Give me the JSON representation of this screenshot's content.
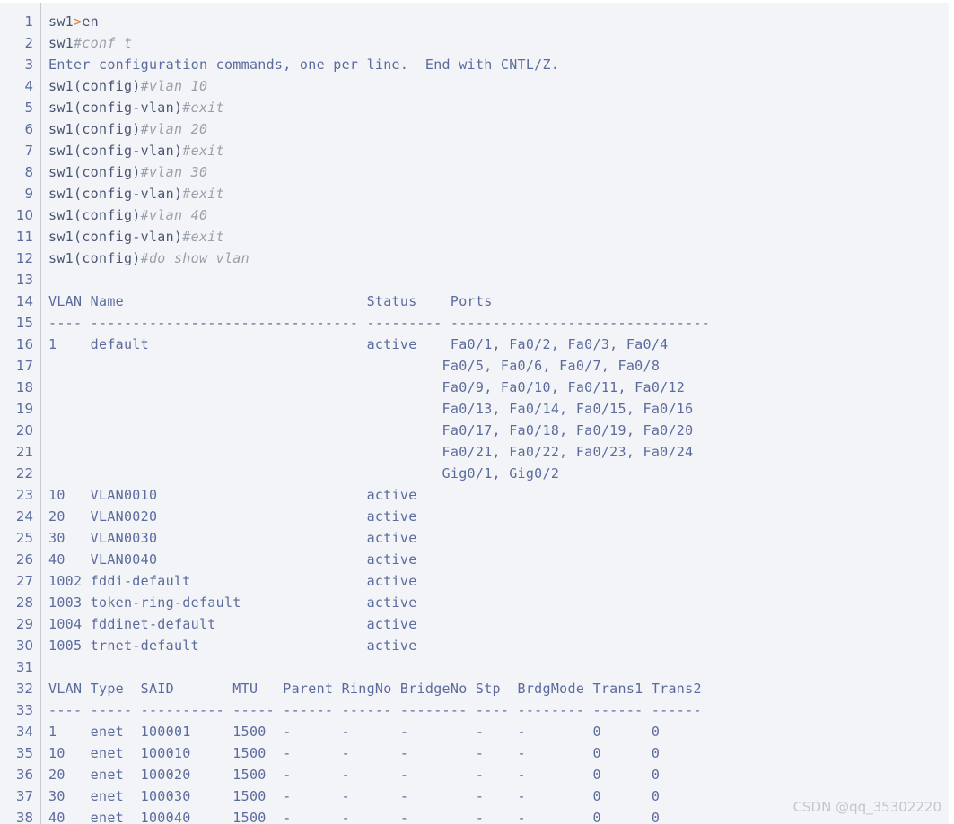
{
  "terminal": {
    "device_prompt": "sw1",
    "watermark": "CSDN @qq_35302220",
    "line_count": 38,
    "colors": {
      "background": "#f2f4f7",
      "gutter_text": "#5c6b9e",
      "gutter_divider": "#c6c9cf",
      "code_text": "#4a5673",
      "output_text": "#5b6b9e",
      "comment_italic": "#9aa0a9",
      "operator": "#d2834a",
      "watermark": "#c3c6cb"
    },
    "lines": [
      {
        "n": 1,
        "parts": [
          {
            "t": "sw1",
            "c": "tok-prompt"
          },
          {
            "t": ">",
            "c": "tok-op"
          },
          {
            "t": "en",
            "c": "tok-plain"
          }
        ]
      },
      {
        "n": 2,
        "parts": [
          {
            "t": "sw1",
            "c": "tok-prompt"
          },
          {
            "t": "#conf t",
            "c": "tok-cmd"
          }
        ]
      },
      {
        "n": 3,
        "parts": [
          {
            "t": "Enter configuration commands, one per line.  End with CNTL/Z.",
            "c": "tok-out"
          }
        ]
      },
      {
        "n": 4,
        "parts": [
          {
            "t": "sw1(config)",
            "c": "tok-prompt"
          },
          {
            "t": "#vlan 10",
            "c": "tok-cmd"
          }
        ]
      },
      {
        "n": 5,
        "parts": [
          {
            "t": "sw1(config-vlan)",
            "c": "tok-prompt"
          },
          {
            "t": "#exit",
            "c": "tok-cmd"
          }
        ]
      },
      {
        "n": 6,
        "parts": [
          {
            "t": "sw1(config)",
            "c": "tok-prompt"
          },
          {
            "t": "#vlan 20",
            "c": "tok-cmd"
          }
        ]
      },
      {
        "n": 7,
        "parts": [
          {
            "t": "sw1(config-vlan)",
            "c": "tok-prompt"
          },
          {
            "t": "#exit",
            "c": "tok-cmd"
          }
        ]
      },
      {
        "n": 8,
        "parts": [
          {
            "t": "sw1(config)",
            "c": "tok-prompt"
          },
          {
            "t": "#vlan 30",
            "c": "tok-cmd"
          }
        ]
      },
      {
        "n": 9,
        "parts": [
          {
            "t": "sw1(config-vlan)",
            "c": "tok-prompt"
          },
          {
            "t": "#exit",
            "c": "tok-cmd"
          }
        ]
      },
      {
        "n": 10,
        "parts": [
          {
            "t": "sw1(config)",
            "c": "tok-prompt"
          },
          {
            "t": "#vlan 40",
            "c": "tok-cmd"
          }
        ]
      },
      {
        "n": 11,
        "parts": [
          {
            "t": "sw1(config-vlan)",
            "c": "tok-prompt"
          },
          {
            "t": "#exit",
            "c": "tok-cmd"
          }
        ]
      },
      {
        "n": 12,
        "parts": [
          {
            "t": "sw1(config)",
            "c": "tok-prompt"
          },
          {
            "t": "#do show vlan",
            "c": "tok-cmd"
          }
        ]
      },
      {
        "n": 13,
        "parts": [
          {
            "t": "",
            "c": "tok-out"
          }
        ]
      },
      {
        "n": 14,
        "parts": [
          {
            "t": "VLAN Name                             Status    Ports",
            "c": "tok-out"
          }
        ]
      },
      {
        "n": 15,
        "parts": [
          {
            "t": "---- -------------------------------- --------- -------------------------------",
            "c": "tok-out"
          }
        ]
      },
      {
        "n": 16,
        "parts": [
          {
            "t": "1    default                          active    Fa0/1, Fa0/2, Fa0/3, Fa0/4",
            "c": "tok-out"
          }
        ]
      },
      {
        "n": 17,
        "parts": [
          {
            "t": "                                               Fa0/5, Fa0/6, Fa0/7, Fa0/8",
            "c": "tok-out"
          }
        ]
      },
      {
        "n": 18,
        "parts": [
          {
            "t": "                                               Fa0/9, Fa0/10, Fa0/11, Fa0/12",
            "c": "tok-out"
          }
        ]
      },
      {
        "n": 19,
        "parts": [
          {
            "t": "                                               Fa0/13, Fa0/14, Fa0/15, Fa0/16",
            "c": "tok-out"
          }
        ]
      },
      {
        "n": 20,
        "parts": [
          {
            "t": "                                               Fa0/17, Fa0/18, Fa0/19, Fa0/20",
            "c": "tok-out"
          }
        ]
      },
      {
        "n": 21,
        "parts": [
          {
            "t": "                                               Fa0/21, Fa0/22, Fa0/23, Fa0/24",
            "c": "tok-out"
          }
        ]
      },
      {
        "n": 22,
        "parts": [
          {
            "t": "                                               Gig0/1, Gig0/2",
            "c": "tok-out"
          }
        ]
      },
      {
        "n": 23,
        "parts": [
          {
            "t": "10   VLAN0010                         active",
            "c": "tok-out"
          }
        ]
      },
      {
        "n": 24,
        "parts": [
          {
            "t": "20   VLAN0020                         active",
            "c": "tok-out"
          }
        ]
      },
      {
        "n": 25,
        "parts": [
          {
            "t": "30   VLAN0030                         active",
            "c": "tok-out"
          }
        ]
      },
      {
        "n": 26,
        "parts": [
          {
            "t": "40   VLAN0040                         active",
            "c": "tok-out"
          }
        ]
      },
      {
        "n": 27,
        "parts": [
          {
            "t": "1002 fddi-default                     active",
            "c": "tok-out"
          }
        ]
      },
      {
        "n": 28,
        "parts": [
          {
            "t": "1003 token-ring-default               active",
            "c": "tok-out"
          }
        ]
      },
      {
        "n": 29,
        "parts": [
          {
            "t": "1004 fddinet-default                  active",
            "c": "tok-out"
          }
        ]
      },
      {
        "n": 30,
        "parts": [
          {
            "t": "1005 trnet-default                    active",
            "c": "tok-out"
          }
        ]
      },
      {
        "n": 31,
        "parts": [
          {
            "t": "",
            "c": "tok-out"
          }
        ]
      },
      {
        "n": 32,
        "parts": [
          {
            "t": "VLAN Type  SAID       MTU   Parent RingNo BridgeNo Stp  BrdgMode Trans1 Trans2",
            "c": "tok-out"
          }
        ]
      },
      {
        "n": 33,
        "parts": [
          {
            "t": "---- ----- ---------- ----- ------ ------ -------- ---- -------- ------ ------",
            "c": "tok-out"
          }
        ]
      },
      {
        "n": 34,
        "parts": [
          {
            "t": "1    enet  100001     1500  -      -      -        -    -        0      0",
            "c": "tok-out"
          }
        ]
      },
      {
        "n": 35,
        "parts": [
          {
            "t": "10   enet  100010     1500  -      -      -        -    -        0      0",
            "c": "tok-out"
          }
        ]
      },
      {
        "n": 36,
        "parts": [
          {
            "t": "20   enet  100020     1500  -      -      -        -    -        0      0",
            "c": "tok-out"
          }
        ]
      },
      {
        "n": 37,
        "parts": [
          {
            "t": "30   enet  100030     1500  -      -      -        -    -        0      0",
            "c": "tok-out"
          }
        ]
      },
      {
        "n": 38,
        "parts": [
          {
            "t": "40   enet  100040     1500  -      -      -        -    -        0      0",
            "c": "tok-out"
          }
        ]
      }
    ],
    "vlan_table": {
      "headers": [
        "VLAN",
        "Name",
        "Status",
        "Ports"
      ],
      "rows": [
        {
          "vlan": "1",
          "name": "default",
          "status": "active",
          "ports": [
            "Fa0/1, Fa0/2, Fa0/3, Fa0/4",
            "Fa0/5, Fa0/6, Fa0/7, Fa0/8",
            "Fa0/9, Fa0/10, Fa0/11, Fa0/12",
            "Fa0/13, Fa0/14, Fa0/15, Fa0/16",
            "Fa0/17, Fa0/18, Fa0/19, Fa0/20",
            "Fa0/21, Fa0/22, Fa0/23, Fa0/24",
            "Gig0/1, Gig0/2"
          ]
        },
        {
          "vlan": "10",
          "name": "VLAN0010",
          "status": "active",
          "ports": []
        },
        {
          "vlan": "20",
          "name": "VLAN0020",
          "status": "active",
          "ports": []
        },
        {
          "vlan": "30",
          "name": "VLAN0030",
          "status": "active",
          "ports": []
        },
        {
          "vlan": "40",
          "name": "VLAN0040",
          "status": "active",
          "ports": []
        },
        {
          "vlan": "1002",
          "name": "fddi-default",
          "status": "active",
          "ports": []
        },
        {
          "vlan": "1003",
          "name": "token-ring-default",
          "status": "active",
          "ports": []
        },
        {
          "vlan": "1004",
          "name": "fddinet-default",
          "status": "active",
          "ports": []
        },
        {
          "vlan": "1005",
          "name": "trnet-default",
          "status": "active",
          "ports": []
        }
      ]
    },
    "vlan_detail_table": {
      "headers": [
        "VLAN",
        "Type",
        "SAID",
        "MTU",
        "Parent",
        "RingNo",
        "BridgeNo",
        "Stp",
        "BrdgMode",
        "Trans1",
        "Trans2"
      ],
      "rows": [
        [
          "1",
          "enet",
          "100001",
          "1500",
          "-",
          "-",
          "-",
          "-",
          "-",
          "0",
          "0"
        ],
        [
          "10",
          "enet",
          "100010",
          "1500",
          "-",
          "-",
          "-",
          "-",
          "-",
          "0",
          "0"
        ],
        [
          "20",
          "enet",
          "100020",
          "1500",
          "-",
          "-",
          "-",
          "-",
          "-",
          "0",
          "0"
        ],
        [
          "30",
          "enet",
          "100030",
          "1500",
          "-",
          "-",
          "-",
          "-",
          "-",
          "0",
          "0"
        ],
        [
          "40",
          "enet",
          "100040",
          "1500",
          "-",
          "-",
          "-",
          "-",
          "-",
          "0",
          "0"
        ]
      ]
    }
  }
}
